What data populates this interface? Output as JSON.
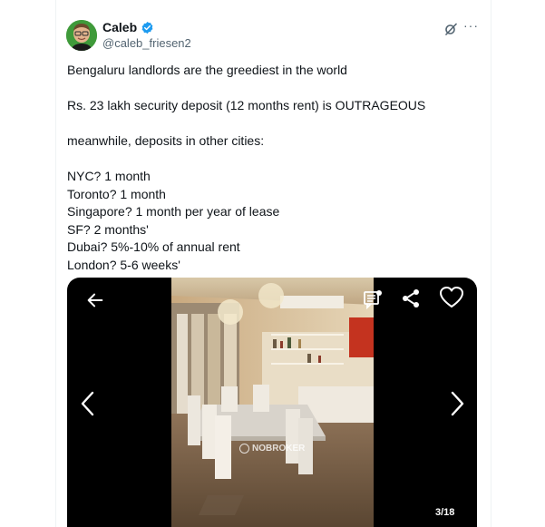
{
  "author": {
    "display_name": "Caleb",
    "handle": "@caleb_friesen2",
    "avatar_icon": "person-avatar-icon",
    "verified_icon": "verified-badge-icon"
  },
  "header_actions": {
    "grok_icon": "grok-icon",
    "more_label": "···"
  },
  "tweet": {
    "lines": [
      "Bengaluru landlords are the greediest in the world",
      "",
      "Rs. 23 lakh security deposit (12 months rent) is OUTRAGEOUS",
      "",
      "meanwhile, deposits in other cities:",
      "",
      "NYC? 1 month",
      "Toronto? 1 month",
      "Singapore? 1 month per year of lease",
      "SF? 2 months'",
      "Dubai? 5%-10% of annual rent",
      "London? 5-6 weeks'"
    ]
  },
  "media_viewer": {
    "counter": "3/18",
    "watermark": "NOBROKER",
    "icons": [
      "back-arrow-icon",
      "previous-chevron-icon",
      "next-chevron-icon",
      "chat-bubble-icon",
      "share-icon",
      "heart-icon"
    ],
    "accent_color": "#1d9bf0"
  }
}
